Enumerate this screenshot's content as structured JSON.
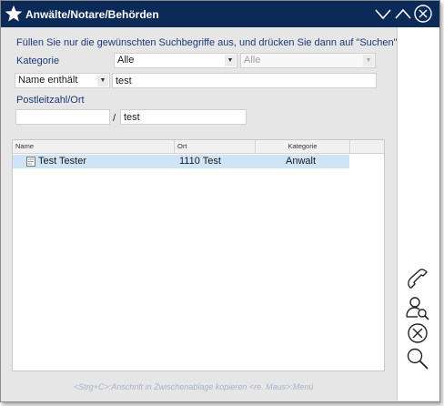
{
  "window": {
    "title": "Anwälte/Notare/Behörden",
    "icons": {
      "app": "star-icon",
      "collapse": "chevron-down-icon",
      "expand": "chevron-up-icon",
      "close": "close-circle-icon"
    }
  },
  "form": {
    "instruction": "Füllen Sie nur die gewünschten Suchbegriffe aus, und drücken Sie dann auf \"Suchen\".",
    "kategorie_label": "Kategorie",
    "kategorie_value": "Alle",
    "kategorie_sub_value": "Alle",
    "name_filter_mode": "Name enthält",
    "name_value": "test",
    "plz_ort_label": "Postleitzahl/Ort",
    "plz_value": "",
    "plz_ort_separator": "/",
    "ort_value": "test"
  },
  "results": {
    "columns": [
      "Name",
      "Ort",
      "Kategorie"
    ],
    "rows": [
      {
        "name": "Test Tester",
        "ort": "1110 Test",
        "kategorie": "Anwalt",
        "selected": true
      }
    ]
  },
  "side_actions": [
    {
      "name": "phone-icon",
      "label": "Telefon"
    },
    {
      "name": "person-search-icon",
      "label": "Person suchen"
    },
    {
      "name": "cancel-circle-icon",
      "label": "Abbrechen"
    },
    {
      "name": "search-icon",
      "label": "Suchen"
    }
  ],
  "statusbar": {
    "hint": "<Strg+C>:Anschrift in Zwischenablage kopieren  <re. Maus>:Menü"
  },
  "colors": {
    "titlebar": "#0b2a57",
    "label_blue": "#1a3a7a",
    "selection": "#cfe5f7",
    "window_bg": "#e6e6e6"
  }
}
